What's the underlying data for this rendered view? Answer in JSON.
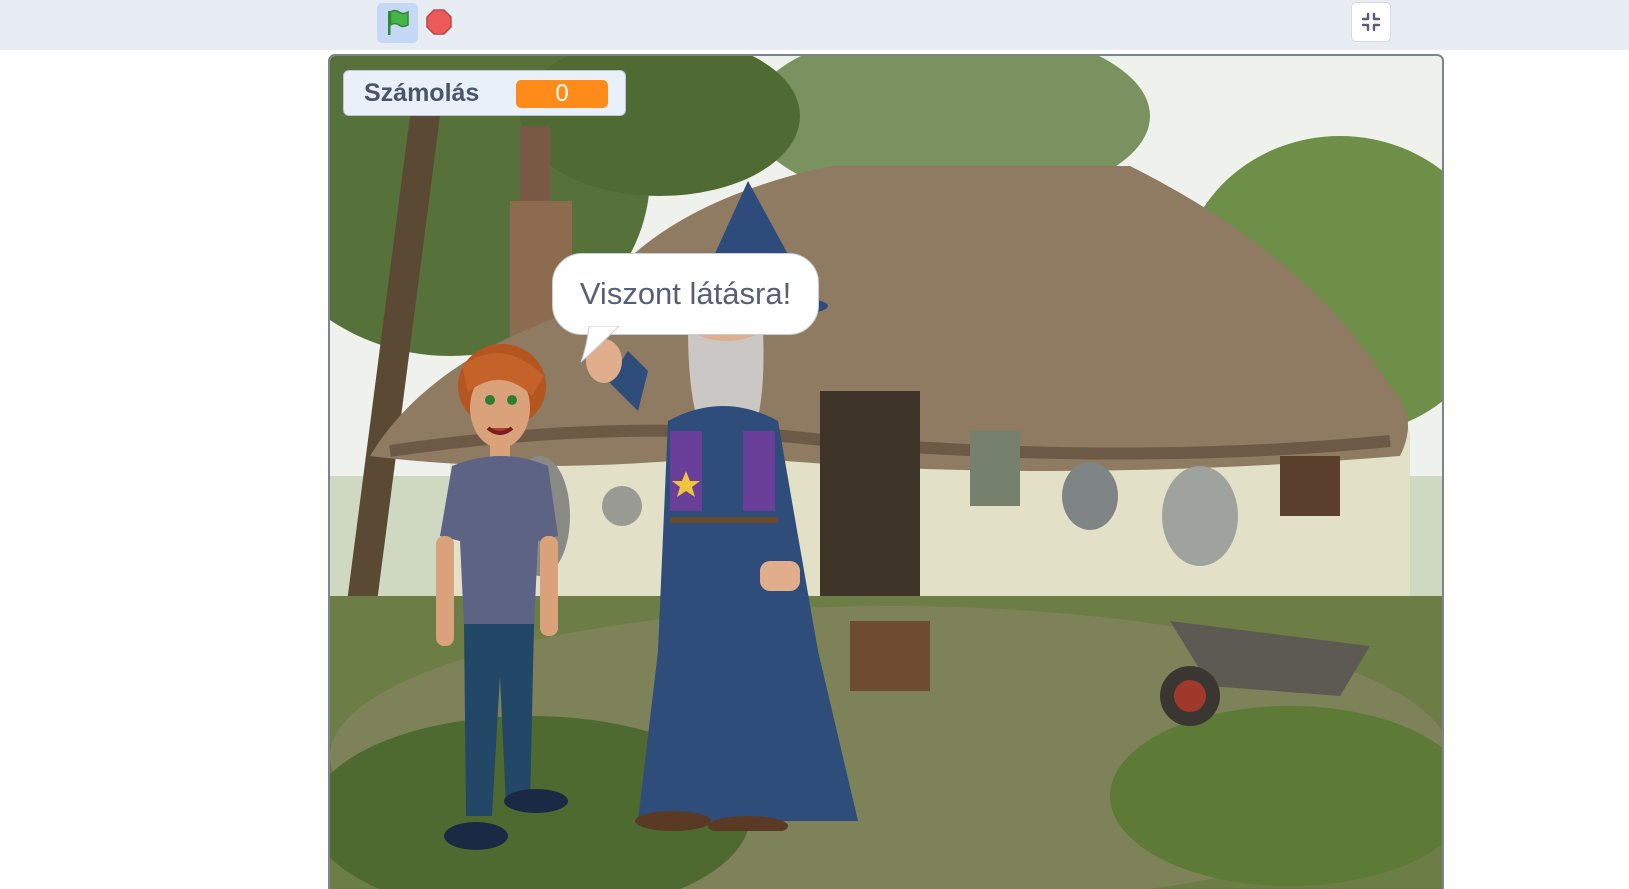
{
  "toolbar": {
    "green_flag_icon": "green-flag-icon",
    "stop_icon": "stop-icon",
    "fullscreen_icon": "exit-fullscreen-icon"
  },
  "stage": {
    "variable_monitor": {
      "label": "Számolás",
      "value": "0"
    },
    "speech_bubble": {
      "text": "Viszont látásra!"
    },
    "backdrop": "thatched cottage",
    "sprites": [
      "boy",
      "wizard"
    ]
  },
  "colors": {
    "topbar_bg": "#e8edf3",
    "flag_active_bg": "#c5d8f5",
    "flag_green": "#45b549",
    "stop_red": "#ec5959",
    "monitor_value_bg": "#ff8c1a",
    "bubble_text": "#575e75"
  }
}
